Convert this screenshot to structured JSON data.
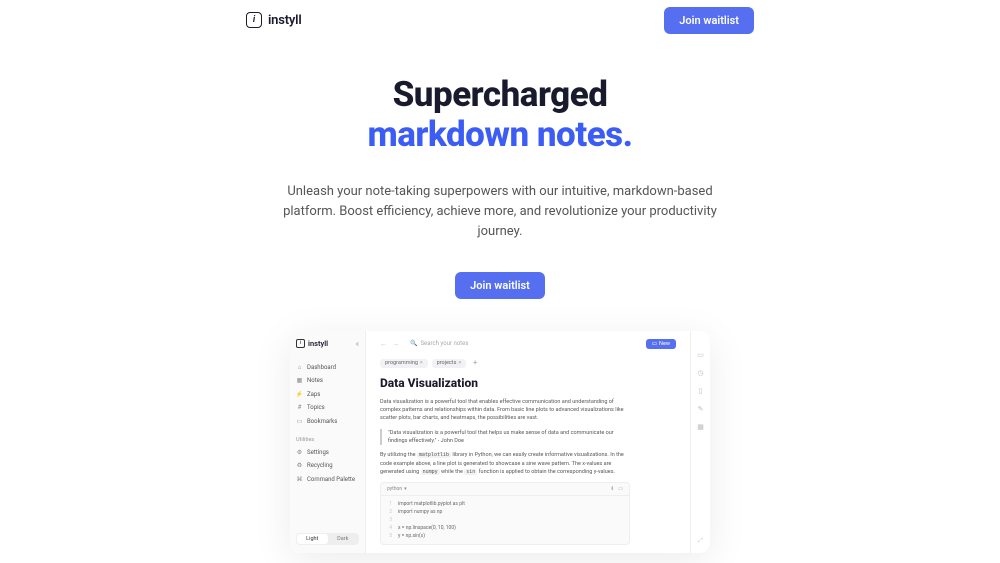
{
  "header": {
    "brand": "instyll",
    "cta": "Join waitlist"
  },
  "hero": {
    "title_line1": "Supercharged",
    "title_line2": "markdown notes.",
    "subtitle": "Unleash your note-taking superpowers with our intuitive, markdown-based platform. Boost efficiency, achieve more, and revolutionize your productivity journey.",
    "cta": "Join waitlist"
  },
  "screenshot": {
    "brand": "instyll",
    "sidebar": {
      "items": [
        {
          "icon": "⌂",
          "label": "Dashboard"
        },
        {
          "icon": "▦",
          "label": "Notes"
        },
        {
          "icon": "⚡",
          "label": "Zaps"
        },
        {
          "icon": "#",
          "label": "Topics"
        },
        {
          "icon": "▭",
          "label": "Bookmarks"
        }
      ],
      "utilities_label": "Utilities",
      "utilities": [
        {
          "icon": "⚙",
          "label": "Settings"
        },
        {
          "icon": "♻",
          "label": "Recycling"
        },
        {
          "icon": "⌘",
          "label": "Command Palette"
        }
      ],
      "theme": {
        "light": "Light",
        "dark": "Dark"
      }
    },
    "topbar": {
      "search_placeholder": "Search your notes",
      "new_label": "New"
    },
    "tags": [
      "programming",
      "projects"
    ],
    "doc": {
      "title": "Data Visualization",
      "p1": "Data visualization is a powerful tool that enables effective communication and understanding of complex patterns and relationships within data. From basic line plots to advanced visualizations like scatter plots, bar charts, and heatmaps, the possibilities are vast.",
      "quote": "\"Data visualization is a powerful tool that helps us make sense of data and communicate our findings effectively.\" - John Doe",
      "p2_a": "By utilizing the ",
      "p2_code1": "matplotlib",
      "p2_b": " library in Python, we can easily create informative visualizations. In the code example above, a line plot is generated to showcase a sine wave pattern. The x-values are generated using ",
      "p2_code2": "numpy",
      "p2_c": " while the ",
      "p2_code3": "sin",
      "p2_d": " function is applied to obtain the corresponding y-values.",
      "code_lang": "python",
      "code_lines": [
        "import matplotlib.pyplot as plt",
        "import numpy as np",
        "",
        "x = np.linspace(0, 10, 100)",
        "y = np.sin(x)"
      ]
    }
  }
}
